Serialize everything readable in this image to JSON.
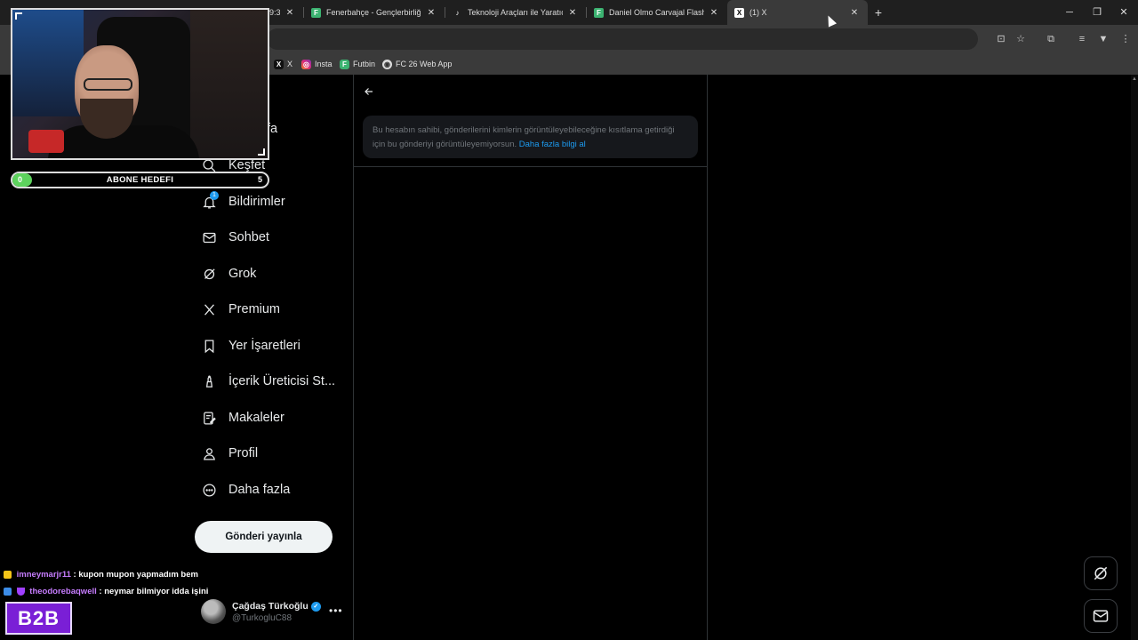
{
  "browser": {
    "tabs": [
      {
        "title": "Fenerbahçe - Gençlerbirliği canlı",
        "favicon": "F",
        "color": "#3cb371"
      },
      {
        "title": "Teknoloji Araçları ile Yaratıcılığı",
        "favicon": "♪",
        "color": "#ffffff"
      },
      {
        "title": "Daniel Olmo Carvajal Flashback",
        "favicon": "F",
        "color": "#3cb371"
      },
      {
        "title": "(1) X",
        "favicon": "X",
        "color": "#ffffff"
      }
    ],
    "partial_tab_text": "9:3",
    "bookmarks": [
      {
        "label": "X",
        "icon": "x-icon"
      },
      {
        "label": "Insta",
        "icon": "instagram-icon"
      },
      {
        "label": "Futbin",
        "icon": "futbin-icon"
      },
      {
        "label": "FC 26 Web App",
        "icon": "globe-icon"
      }
    ]
  },
  "sidebar": {
    "partial_home": "fa",
    "items": [
      {
        "label": "Keşfet",
        "icon": "search-icon"
      },
      {
        "label": "Bildirimler",
        "icon": "bell-icon",
        "badge": "1"
      },
      {
        "label": "Sohbet",
        "icon": "mail-icon"
      },
      {
        "label": "Grok",
        "icon": "grok-icon"
      },
      {
        "label": "Premium",
        "icon": "x-logo-icon"
      },
      {
        "label": "Yer İşaretleri",
        "icon": "bookmark-icon"
      },
      {
        "label": "İçerik Üreticisi St...",
        "icon": "creator-studio-icon"
      },
      {
        "label": "Makaleler",
        "icon": "articles-icon"
      },
      {
        "label": "Profil",
        "icon": "profile-icon"
      },
      {
        "label": "Daha fazla",
        "icon": "more-circle-icon"
      }
    ],
    "post_button": "Gönderi yayınla",
    "account": {
      "display_name": "Çağdaş Türkoğlu",
      "handle": "@TurkogluC88",
      "verified": true
    }
  },
  "main": {
    "notice_text": "Bu hesabın sahibi, gönderilerini kimlerin görüntüleyebileceğine kısıtlama getirdiği için bu gönderiyi görüntüleyemiyorsun.",
    "notice_link": "Daha fazla bilgi al"
  },
  "overlay": {
    "goal": {
      "start": "0",
      "label": "ABONE HEDEFI",
      "end": "5",
      "progress": 0.05
    },
    "chat": [
      {
        "user": "imneymarjr11",
        "message": ": kupon mupon yapmadım bem"
      },
      {
        "user": "theodorebaqwell",
        "message": ": neymar bilmiyor idda işini"
      }
    ],
    "logo_text": "B2B"
  },
  "colors": {
    "accent": "#1d9bf0",
    "goal_fill": "#5dd35d",
    "logo_bg": "#7a1fd6"
  }
}
